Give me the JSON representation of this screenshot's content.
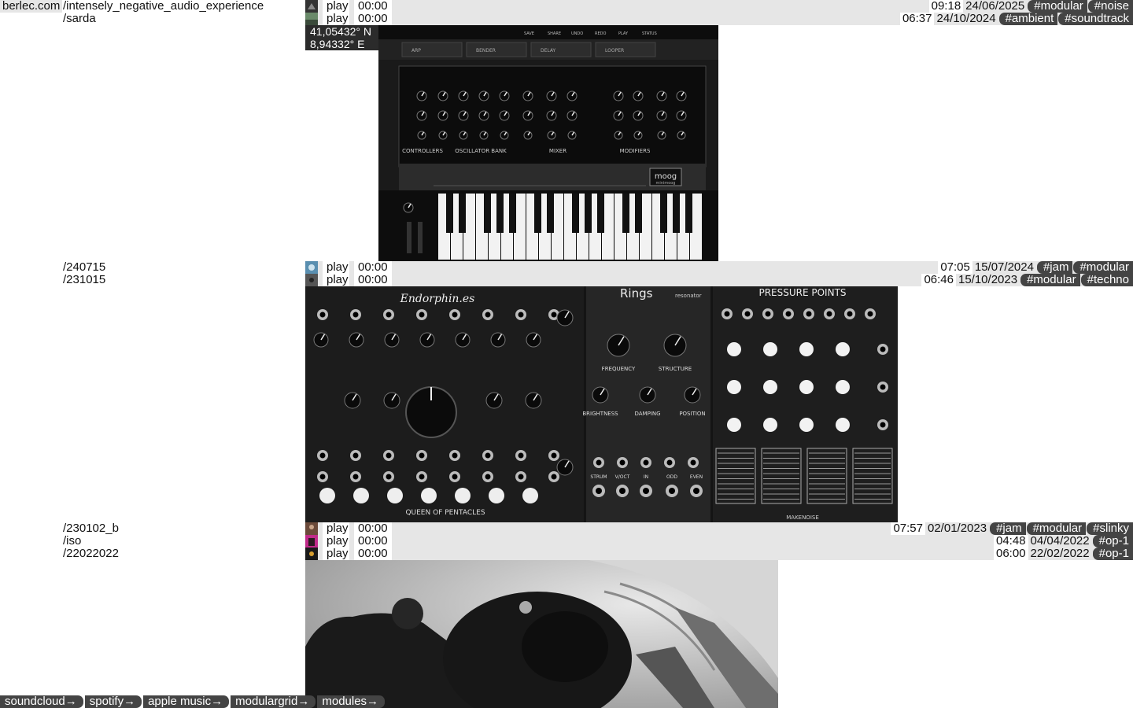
{
  "site": {
    "domain": "berlec.com"
  },
  "tracks": [
    {
      "path": "/intensely_negative_audio_experience",
      "play_label": "play",
      "position": "00:00",
      "duration": "09:18",
      "date": "24/06/2025",
      "tags": [
        "#modular",
        "#noise"
      ]
    },
    {
      "path": "/sarda",
      "play_label": "play",
      "position": "00:00",
      "duration": "06:37",
      "date": "24/10/2024",
      "tags": [
        "#ambient",
        "#soundtrack"
      ]
    },
    {
      "path": "/240715",
      "play_label": "play",
      "position": "00:00",
      "duration": "07:05",
      "date": "15/07/2024",
      "tags": [
        "#jam",
        "#modular"
      ]
    },
    {
      "path": "/231015",
      "play_label": "play",
      "position": "00:00",
      "duration": "06:46",
      "date": "15/10/2023",
      "tags": [
        "#modular",
        "#techno"
      ]
    },
    {
      "path": "/230102_b",
      "play_label": "play",
      "position": "00:00",
      "duration": "07:57",
      "date": "02/01/2023",
      "tags": [
        "#jam",
        "#modular",
        "#slinky"
      ]
    },
    {
      "path": "/iso",
      "play_label": "play",
      "position": "00:00",
      "duration": "04:48",
      "date": "04/04/2022",
      "tags": [
        "#op-1"
      ]
    },
    {
      "path": "/22022022",
      "play_label": "play",
      "position": "00:00",
      "duration": "06:00",
      "date": "22/02/2022",
      "tags": [
        "#op-1"
      ]
    }
  ],
  "location": {
    "lat": "41,05432° N",
    "lon": "8,94332° E"
  },
  "synth": {
    "toolbar": [
      "SAVE",
      "SHARE",
      "UNDO",
      "REDO",
      "PLAY",
      "STATUS"
    ],
    "fx": [
      "ARP",
      "BENDER",
      "DELAY",
      "LOOPER"
    ],
    "sections": [
      "CONTROLLERS",
      "OSCILLATOR BANK",
      "MIXER",
      "MODIFIERS"
    ],
    "brand": "moog",
    "model": "minimoog"
  },
  "modules": {
    "endorphines": {
      "brand": "Endorphin.es",
      "name": "QUEEN OF PENTACLES"
    },
    "rings": {
      "title": "Rings",
      "subtitle": "resonator",
      "knobs": [
        "FREQUENCY",
        "STRUCTURE",
        "BRIGHTNESS",
        "DAMPING",
        "POSITION"
      ],
      "jacks": [
        "STRUM",
        "V/OCT",
        "IN",
        "ODD",
        "EVEN"
      ]
    },
    "pressure": {
      "title": "PRESSURE POINTS",
      "brand": "MAKENOISE"
    }
  },
  "footer_links": [
    "soundcloud→",
    "spotify→",
    "apple music→",
    "modulargrid→",
    "modules→"
  ],
  "colors": {
    "row_bg": "#e6e6e6",
    "tag_bg": "#444444",
    "tag_text": "#ffffff"
  }
}
